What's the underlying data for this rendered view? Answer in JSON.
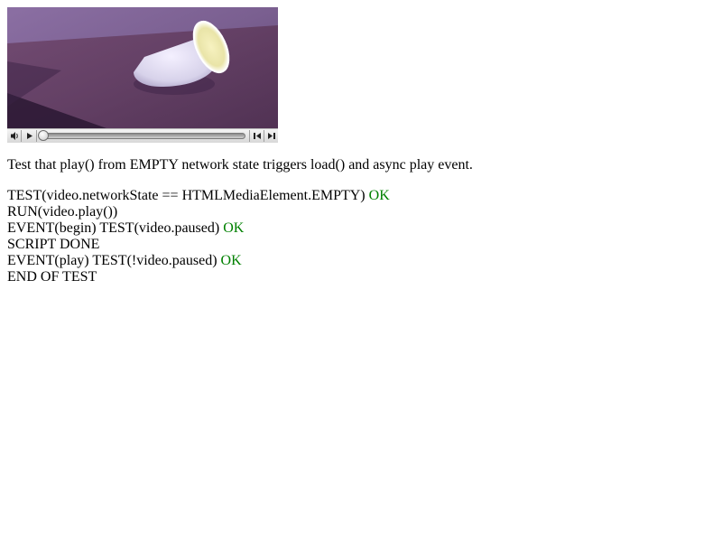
{
  "video": {
    "controls": {
      "volume_icon": "speaker-icon",
      "play_icon": "play-icon",
      "rewind_icon": "step-back-icon",
      "forward_icon": "step-forward-icon",
      "playback_position": 0
    }
  },
  "description": "Test that play() from EMPTY network state triggers load() and async play event.",
  "log": [
    {
      "text": "TEST(video.networkState == HTMLMediaElement.EMPTY)",
      "status": "OK"
    },
    {
      "text": "RUN(video.play())",
      "status": ""
    },
    {
      "text": "EVENT(begin) TEST(video.paused)",
      "status": "OK"
    },
    {
      "text": "SCRIPT DONE",
      "status": ""
    },
    {
      "text": "EVENT(play) TEST(!video.paused)",
      "status": "OK"
    },
    {
      "text": "END OF TEST",
      "status": ""
    }
  ],
  "colors": {
    "ok": "#008000",
    "text": "#000000"
  }
}
